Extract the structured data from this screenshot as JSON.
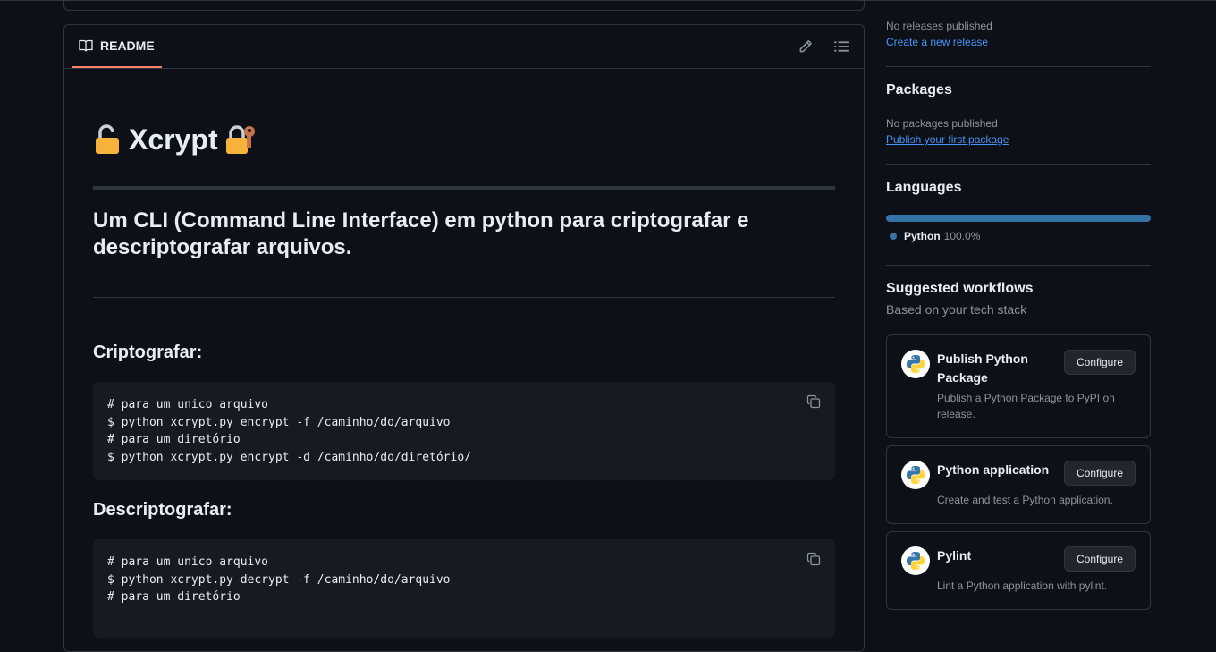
{
  "readme": {
    "tab_label": "README",
    "title": "Xcrypt",
    "subtitle": "Um CLI (Command Line Interface) em python para criptografar e descriptografar arquivos.",
    "sections": [
      {
        "heading": "Criptografar:",
        "code": [
          {
            "type": "comment",
            "text": "# para um unico arquivo"
          },
          {
            "type": "cmd",
            "text": "$ python xcrypt.py encrypt -f /caminho/do/arquivo"
          },
          {
            "type": "comment",
            "text": "# para um diretório"
          },
          {
            "type": "cmd",
            "text": "$ python xcrypt.py encrypt -d /caminho/do/diretório/"
          }
        ]
      },
      {
        "heading": "Descriptografar:",
        "code": [
          {
            "type": "comment",
            "text": "# para um unico arquivo"
          },
          {
            "type": "cmd",
            "text": "$ python xcrypt.py decrypt -f /caminho/do/arquivo"
          },
          {
            "type": "comment",
            "text": "# para um diretório"
          }
        ]
      }
    ]
  },
  "sidebar": {
    "releases": {
      "empty_text": "No releases published",
      "link": "Create a new release"
    },
    "packages": {
      "heading": "Packages",
      "empty_text": "No packages published",
      "link": "Publish your first package"
    },
    "languages": {
      "heading": "Languages",
      "items": [
        {
          "name": "Python",
          "percent": "100.0%",
          "color": "#3572A5"
        }
      ]
    },
    "workflows": {
      "heading": "Suggested workflows",
      "subheading": "Based on your tech stack",
      "button_label": "Configure",
      "cards": [
        {
          "title": "Publish Python Package",
          "desc": "Publish a Python Package to PyPI on release."
        },
        {
          "title": "Python application",
          "desc": "Create and test a Python application."
        },
        {
          "title": "Pylint",
          "desc": "Lint a Python application with pylint."
        }
      ]
    }
  },
  "colors": {
    "accent_tab": "#f78166",
    "link": "#4493f8",
    "bg": "#0d1117",
    "code_bg": "#161b22"
  }
}
